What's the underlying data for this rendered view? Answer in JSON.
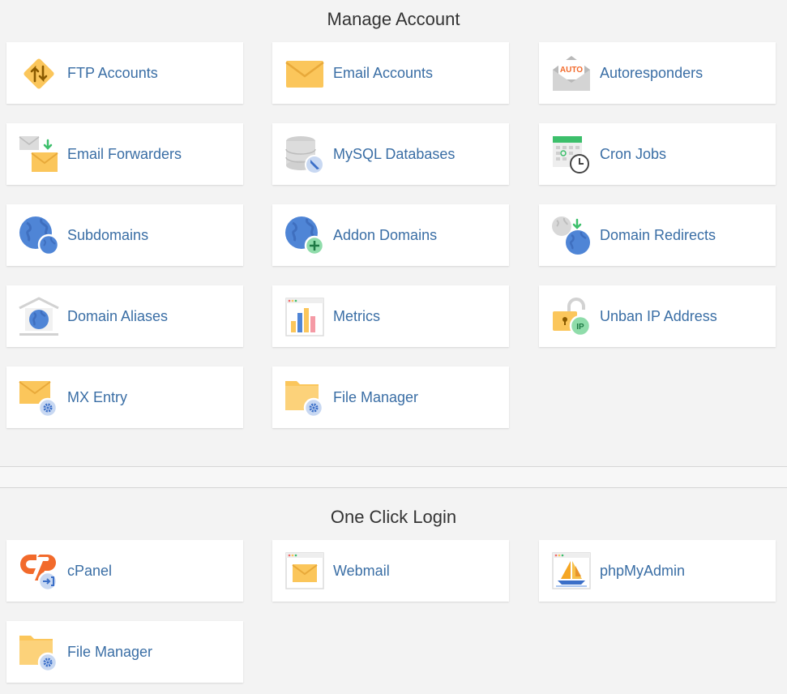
{
  "manage": {
    "title": "Manage Account",
    "items": [
      {
        "label": "FTP Accounts",
        "icon": "ftp-icon"
      },
      {
        "label": "Email Accounts",
        "icon": "email-icon"
      },
      {
        "label": "Autoresponders",
        "icon": "autoresponder-icon",
        "badge": "AUTO"
      },
      {
        "label": "Email Forwarders",
        "icon": "email-forwarder-icon"
      },
      {
        "label": "MySQL Databases",
        "icon": "database-icon"
      },
      {
        "label": "Cron Jobs",
        "icon": "cron-calendar-icon"
      },
      {
        "label": "Subdomains",
        "icon": "subdomain-globe-icon"
      },
      {
        "label": "Addon Domains",
        "icon": "addon-globe-icon"
      },
      {
        "label": "Domain Redirects",
        "icon": "redirect-globe-icon"
      },
      {
        "label": "Domain Aliases",
        "icon": "alias-globe-icon"
      },
      {
        "label": "Metrics",
        "icon": "metrics-chart-icon"
      },
      {
        "label": "Unban IP Address",
        "icon": "unlock-ip-icon",
        "badge": "IP"
      },
      {
        "label": "MX Entry",
        "icon": "mx-envelope-gear-icon"
      },
      {
        "label": "File Manager",
        "icon": "folder-gear-icon"
      }
    ]
  },
  "oneclick": {
    "title": "One Click Login",
    "items": [
      {
        "label": "cPanel",
        "icon": "cpanel-logo-icon"
      },
      {
        "label": "Webmail",
        "icon": "webmail-icon"
      },
      {
        "label": "phpMyAdmin",
        "icon": "phpmyadmin-sailboat-icon"
      },
      {
        "label": "File Manager",
        "icon": "folder-gear-icon"
      }
    ]
  },
  "colors": {
    "link": "#3a6ea5",
    "envelope": "#fbc65b",
    "globe": "#4f85d6",
    "green": "#3cbf6b",
    "cpanel_orange": "#f26a2b"
  }
}
